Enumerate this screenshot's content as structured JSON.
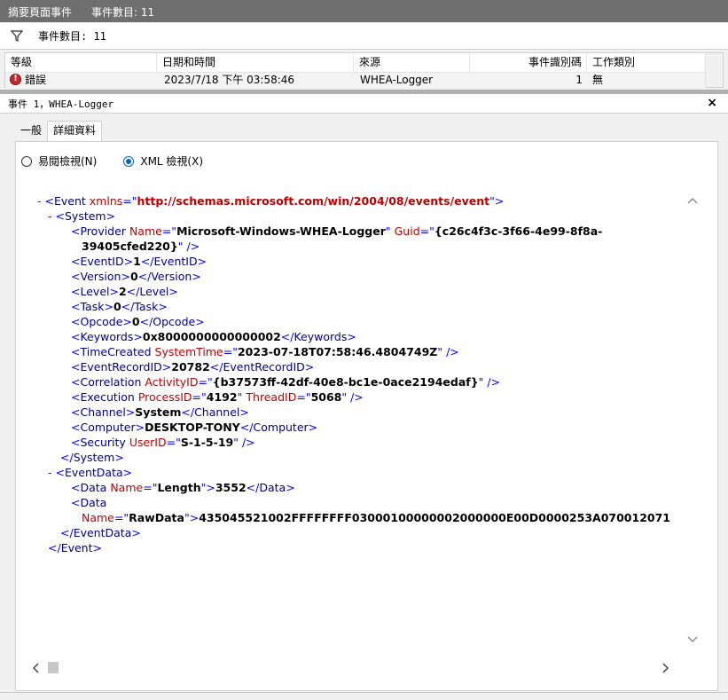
{
  "title": {
    "main": "摘要頁面事件",
    "sub": "事件數目: 11"
  },
  "filter": {
    "label": "事件數目: 11"
  },
  "grid": {
    "columns": [
      "等級",
      "日期和時間",
      "來源",
      "事件識別碼",
      "工作類別"
    ],
    "row": {
      "level": "錯誤",
      "datetime": "2023/7/18 下午 03:58:46",
      "source": "WHEA-Logger",
      "event_id": "1",
      "task_category": "無"
    }
  },
  "detail": {
    "header": "事件 1，WHEA-Logger",
    "close": "×",
    "tabs": [
      "一般",
      "詳細資料"
    ],
    "active_tab": "詳細資料",
    "radios": {
      "friendly": "易閱檢視(N)",
      "xml": "XML 檢視(X)",
      "selected": "xml"
    }
  },
  "xml": {
    "event_open": "Event",
    "xmlns_attr": "xmlns",
    "xmlns_value": "http://schemas.microsoft.com/win/2004/08/events/event",
    "system": "System",
    "provider_name": "Microsoft-Windows-WHEA-Logger",
    "provider_guid_1": "{c26c4f3c-3f66-4e99-8f8a-",
    "provider_guid_2": "39405cfed220}",
    "event_id": "1",
    "version": "0",
    "level": "2",
    "task": "0",
    "opcode": "0",
    "keywords": "0x8000000000000002",
    "time_created": "2023-07-18T07:58:46.4804749Z",
    "event_record_id": "20782",
    "activity_id": "{b37573ff-42df-40e8-bc1e-0ace2194edaf}",
    "process_id": "4192",
    "thread_id": "5068",
    "channel": "System",
    "computer": "DESKTOP-TONY",
    "user_id": "S-1-5-19",
    "event_data": "EventData",
    "data1_name": "Length",
    "data1_value": "3552",
    "data2_name": "RawData",
    "data2_value": "435045521002FFFFFFFF03000100000002000000E00D0000253A070012071"
  },
  "colors": {
    "accent": "#0067c0",
    "tag": "#00008b",
    "attr": "#c00000",
    "error": "#c1282d"
  }
}
